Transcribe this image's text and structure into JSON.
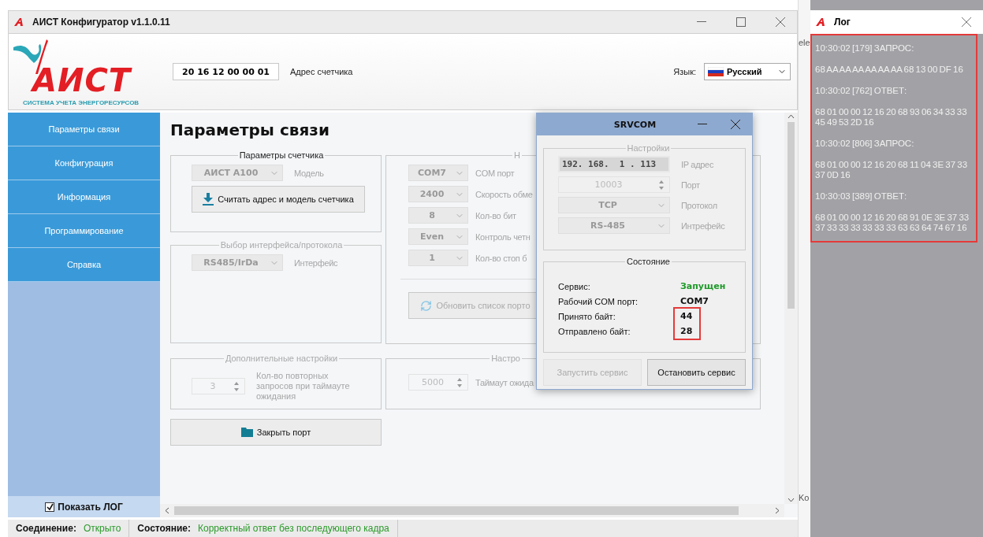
{
  "window": {
    "title": "АИСТ Конфигуратор v1.1.0.11"
  },
  "header": {
    "logo_text": "АИСТ",
    "logo_subtitle": "СИСТЕМА УЧЕТА ЭНЕРГОРЕСУРСОВ",
    "address": {
      "value": "20 16 12 00 00 01",
      "label": "Адрес счетчика"
    },
    "language": {
      "label": "Язык:",
      "value": "Русский"
    }
  },
  "sidebar": {
    "items": [
      "Параметры связи",
      "Конфигурация",
      "Информация",
      "Программирование",
      "Справка"
    ],
    "show_log": {
      "label": "Показать ЛОГ",
      "checked": true
    }
  },
  "content": {
    "title": "Параметры связи",
    "meter_group": {
      "title": "Параметры счетчика",
      "model": {
        "value": "АИСТ А100",
        "label": "Модель"
      },
      "read_button": "Считать адрес и модель счетчика"
    },
    "interface_group": {
      "title": "Выбор интерфейса/протокола",
      "field": {
        "value": "RS485/IrDa",
        "label": "Интерфейс"
      }
    },
    "port_group": {
      "title": "Н",
      "fields": [
        {
          "value": "COM7",
          "label": "COM порт"
        },
        {
          "value": "2400",
          "label": "Скорость обме"
        },
        {
          "value": "8",
          "label": "Кол-во бит"
        },
        {
          "value": "Even",
          "label": "Контроль четн"
        },
        {
          "value": "1",
          "label": "Кол-во стоп б"
        }
      ],
      "refresh_button": "Обновить список порто"
    },
    "extra_group": {
      "title": "Дополнительные настройки",
      "field": {
        "value": "3",
        "label": "Кол-во повторных запросов при таймауте ожидания"
      }
    },
    "timeout_group": {
      "title": "Настро",
      "field": {
        "value": "5000",
        "label": "Таймаут ожида"
      }
    },
    "close_button": "Закрыть порт"
  },
  "srvcom": {
    "title": "SRVCOM",
    "settings": {
      "title": "Настройки",
      "fields": [
        {
          "kind": "ip",
          "value": "192. 168.  1 . 113",
          "label": "IP адрес"
        },
        {
          "kind": "spin",
          "value": "10003",
          "label": "Порт"
        },
        {
          "kind": "combo",
          "value": "TCP",
          "label": "Протокол"
        },
        {
          "kind": "combo",
          "value": "RS-485",
          "label": "Интрефейс"
        }
      ]
    },
    "status": {
      "title": "Состояние",
      "rows": [
        {
          "label": "Сервис:",
          "value": "Запущен",
          "kind": "ok",
          "highlighted": false
        },
        {
          "label": "Рабочий COM порт:",
          "value": "COM7",
          "kind": "plain",
          "highlighted": false
        },
        {
          "label": "Принято байт:",
          "value": "44",
          "kind": "plain",
          "highlighted": true
        },
        {
          "label": "Отправлено байт:",
          "value": "28",
          "kind": "plain",
          "highlighted": true
        }
      ]
    },
    "buttons": [
      {
        "label": "Запустить сервис",
        "disabled": true
      },
      {
        "label": "Остановить сервис",
        "disabled": false
      }
    ]
  },
  "background_window": {
    "fragments": [
      "ele",
      "Ko"
    ]
  },
  "log": {
    "title": "Лог",
    "highlighted": true,
    "entries": [
      "10:30:02 [179] ЗАПРОС:",
      "68 AA AA AA AA AA AA 68 13 00 DF 16",
      "10:30:02 [762] ОТВЕТ:",
      "68 01 00 00 12 16 20 68 93 06 34 33 33 45 49 53 2D 16",
      "10:30:02 [806] ЗАПРОС:",
      "68 01 00 00 12 16 20 68 11 04 3E 37 33 37 0D 16",
      "10:30:03 [389] ОТВЕТ:",
      "68 01 00 00 12 16 20 68 91 0E 3E 37 33 37 33 33 33 33 33 33 63 63 64 74 67 16"
    ]
  },
  "status_bar": [
    {
      "label": "Соединение:",
      "value": "Открыто"
    },
    {
      "label": "Состояние:",
      "value": "Корректный ответ без последующего кадра"
    }
  ]
}
